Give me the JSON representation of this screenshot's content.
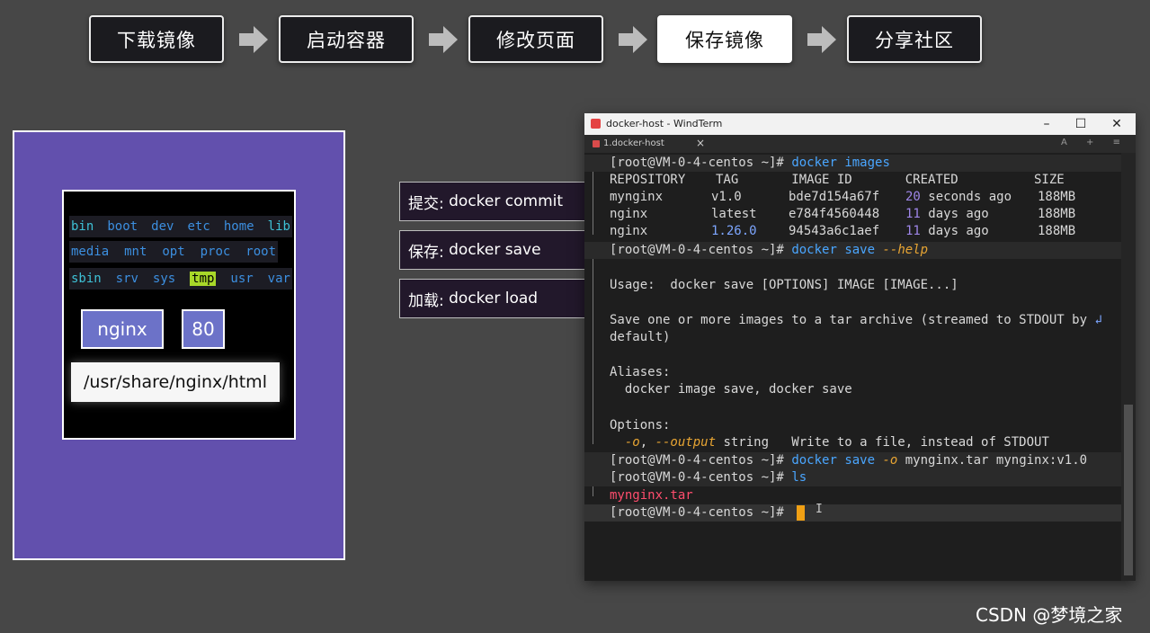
{
  "steps": [
    {
      "label": "下载镜像",
      "active": false
    },
    {
      "label": "启动容器",
      "active": false
    },
    {
      "label": "修改页面",
      "active": false
    },
    {
      "label": "保存镜像",
      "active": true
    },
    {
      "label": "分享社区",
      "active": false
    }
  ],
  "diagram": {
    "dirs_row1": [
      "bin",
      "boot",
      "dev",
      "etc",
      "home",
      "lib"
    ],
    "dirs_row2": [
      "media",
      "mnt",
      "opt",
      "proc",
      "root"
    ],
    "dirs_row3": [
      "sbin",
      "srv",
      "sys",
      "tmp",
      "usr",
      "var"
    ],
    "image_name": "nginx",
    "port": "80",
    "html_path": "/usr/share/nginx/html"
  },
  "commands": [
    {
      "label": "提交:",
      "cmd": "docker commit"
    },
    {
      "label": "保存:",
      "cmd": "docker save"
    },
    {
      "label": "加载:",
      "cmd": "docker load"
    }
  ],
  "terminal": {
    "window_title": "docker-host - WindTerm",
    "minimize_icon": "minimize-icon",
    "maximize_icon": "maximize-icon",
    "close_icon": "close-icon",
    "tab_label": "1.docker-host",
    "tab_tools": "A + ≡",
    "prompt": "[root@VM-0-4-centos ~]#",
    "cmd_images": "docker images",
    "table_header": "REPOSITORY    TAG       IMAGE ID       CREATED          SIZE",
    "rows": [
      {
        "repo": "mynginx",
        "tag": "v1.0",
        "id": "bde7d154a67f",
        "created_num": "20",
        "created_rest": " seconds ago",
        "size": "188MB"
      },
      {
        "repo": "nginx",
        "tag": "latest",
        "id": "e784f4560448",
        "created_num": "11",
        "created_rest": " days ago",
        "size": "188MB"
      },
      {
        "repo": "nginx",
        "tag": "1.26.0",
        "id": "94543a6c1aef",
        "created_num": "11",
        "created_rest": " days ago",
        "size": "188MB"
      }
    ],
    "cmd_save": "docker save",
    "opt_help": "--help",
    "usage": "Usage:  docker save [OPTIONS] IMAGE [IMAGE...]",
    "desc1": "Save one or more images to a tar archive (streamed to STDOUT by",
    "wrap_glyph": "↲",
    "desc2": "default)",
    "aliases_label": "Aliases:",
    "aliases": "  docker image save, docker save",
    "options_label": "Options:",
    "opt_o": "-o",
    "opt_output": "--output",
    "opt_output_rest": " string   Write to a file, instead of STDOUT",
    "cmd_save2": "docker save",
    "opt_o2": "-o",
    "save_args": " mynginx.tar mynginx",
    "save_tag": ":v1.0",
    "cmd_ls": "ls",
    "ls_output": "mynginx.tar",
    "ibeam": "I"
  },
  "watermark": "CSDN @梦境之家"
}
